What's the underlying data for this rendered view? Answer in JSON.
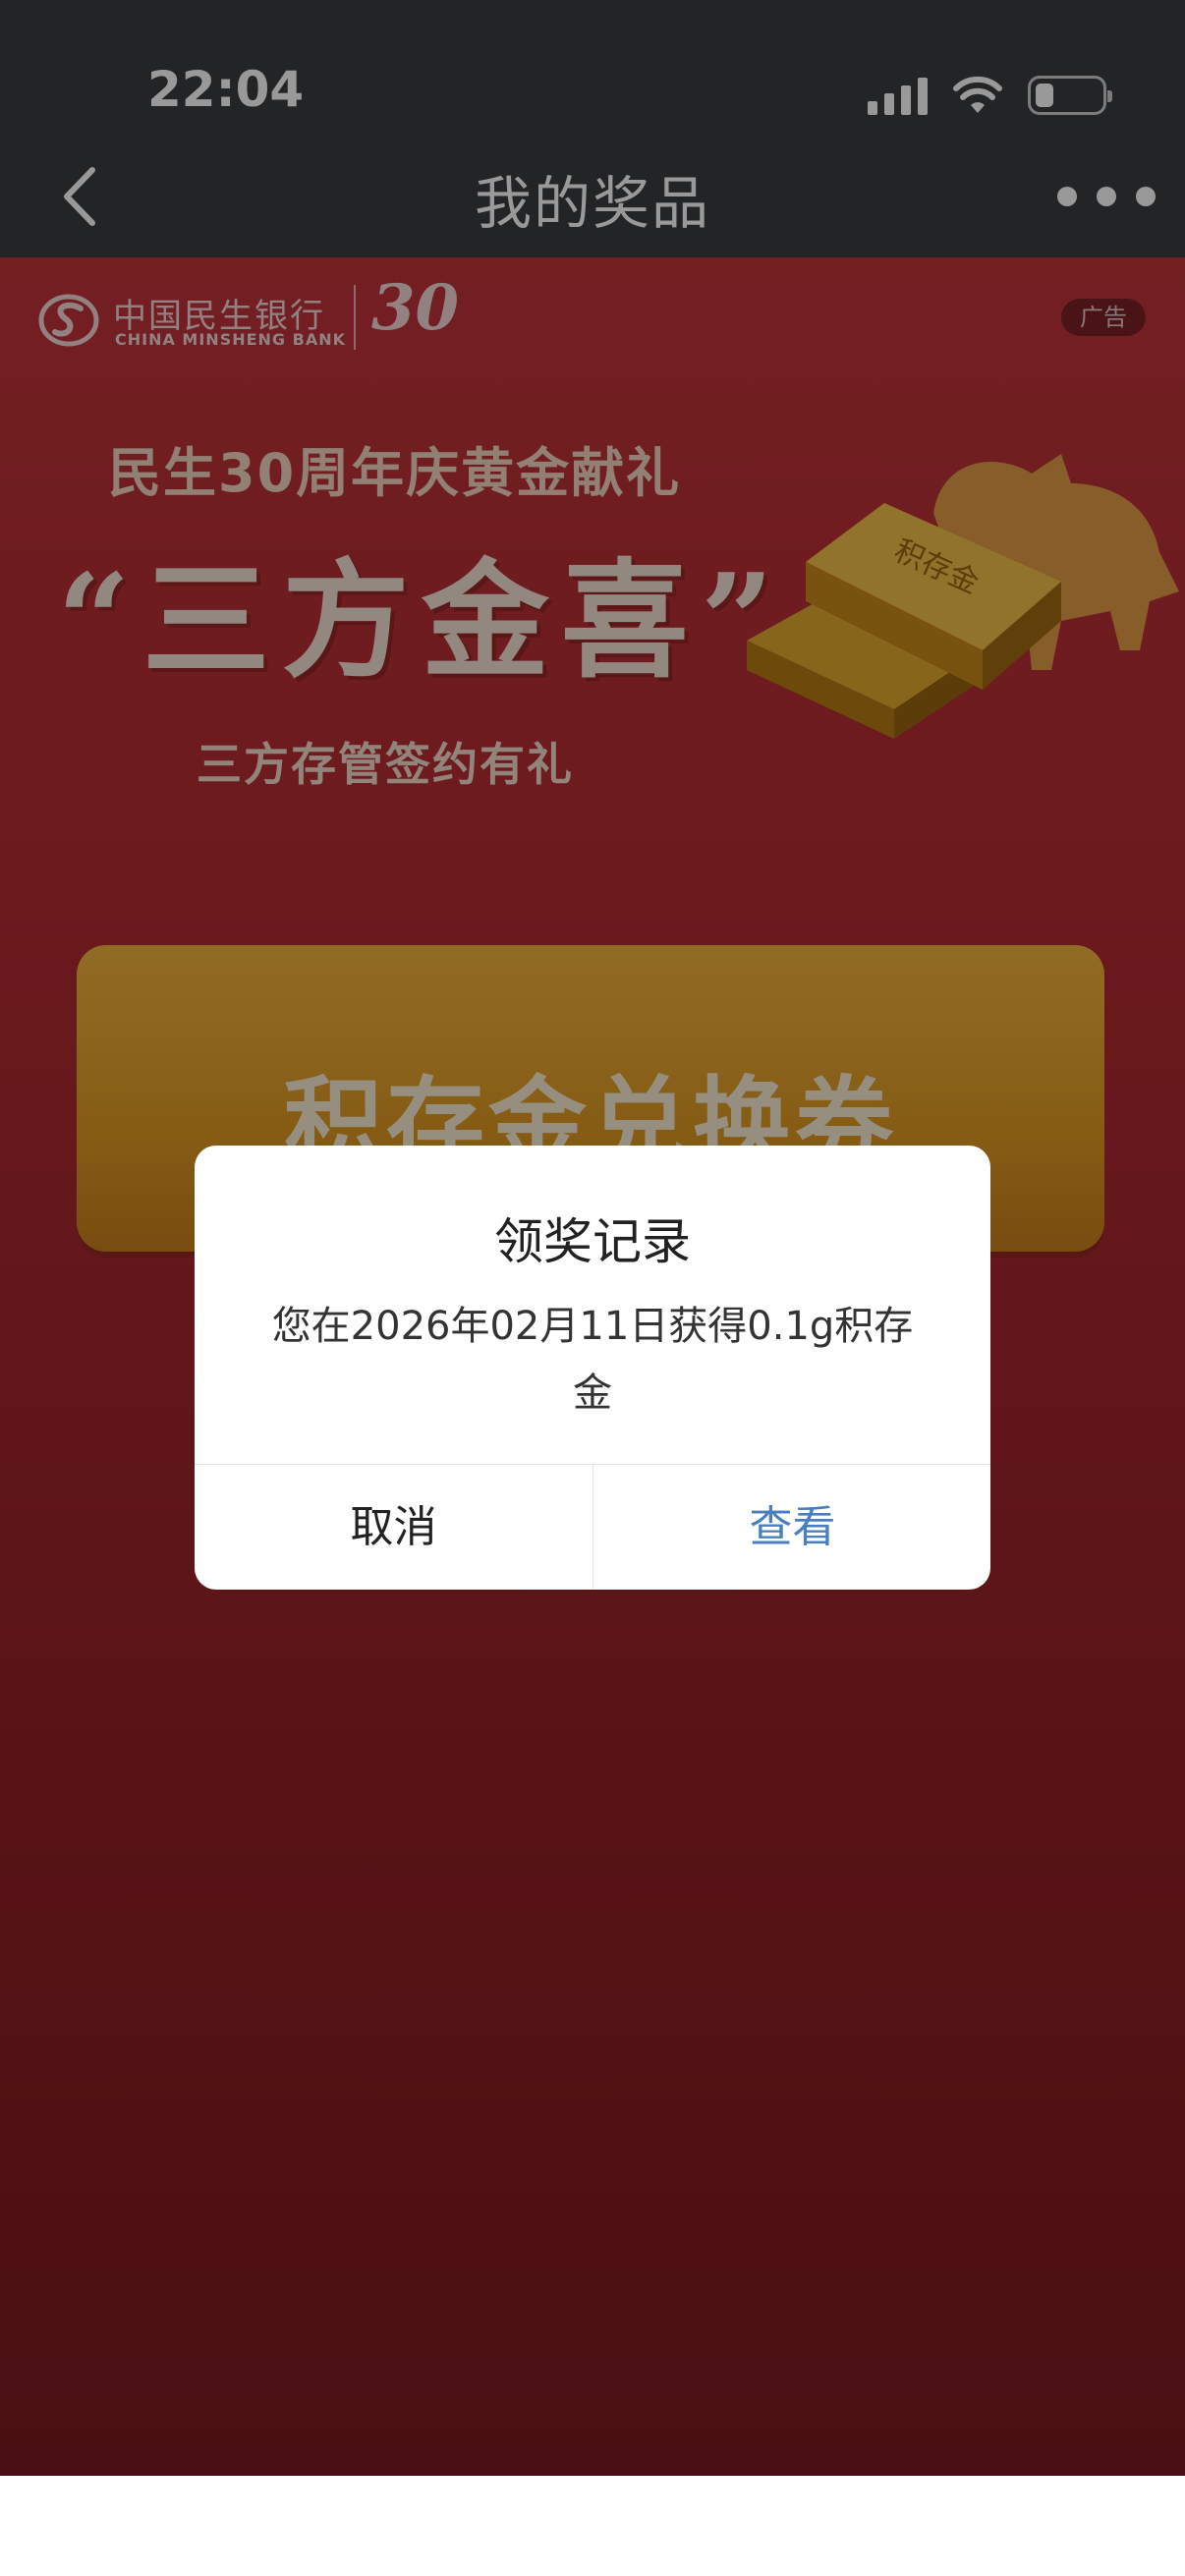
{
  "status_bar": {
    "time": "22:04"
  },
  "nav": {
    "title": "我的奖品"
  },
  "ad": {
    "bank_name_cn": "中国民生银行",
    "bank_name_en": "CHINA MINSHENG BANK",
    "anniversary": "30",
    "ad_tag": "广告",
    "headline": "民生30周年庆黄金献礼",
    "big_title": "“三方金喜”",
    "subtitle": "三方存管签约有礼",
    "gold_bar_text": "积存金",
    "coupon_text": "积存金兑换券"
  },
  "dialog": {
    "title": "领奖记录",
    "message": "您在2026年02月11日获得0.1g积存金",
    "cancel_label": "取消",
    "view_label": "查看"
  },
  "colors": {
    "topbar": "#3b3c40",
    "banner_red": "#b52d33",
    "coupon_gold": "#e09a23",
    "link_blue": "#4a7fbf"
  }
}
